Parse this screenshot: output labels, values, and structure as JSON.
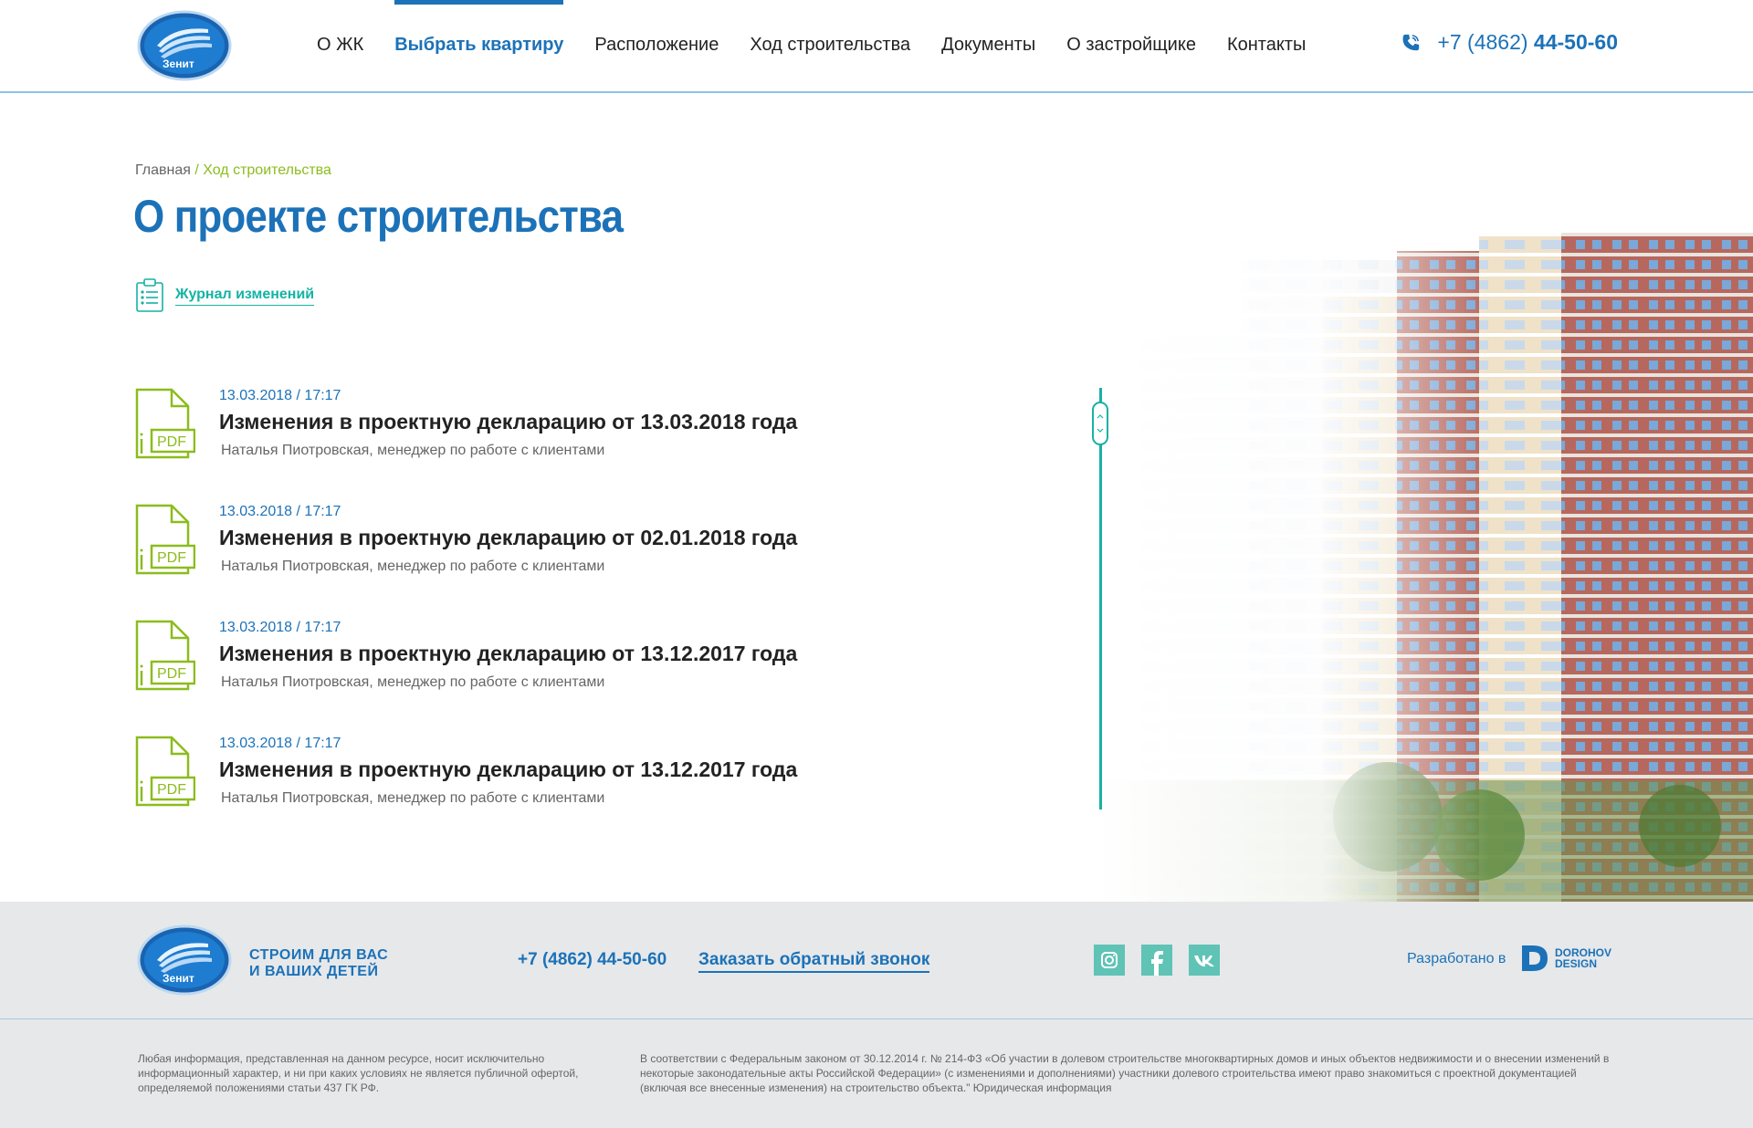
{
  "header": {
    "logo_text": "Зенит",
    "nav": [
      "О ЖК",
      "Выбрать квартиру",
      "Расположение",
      "Ход строительства",
      "Документы",
      "О застройщике",
      "Контакты"
    ],
    "active_index": 1,
    "phone_prefix": "+7 (4862)",
    "phone_number": "44-50-60"
  },
  "breadcrumb": {
    "home": "Главная",
    "separator": " / ",
    "current": "Ход строительства"
  },
  "page_title": "О проекте строительства",
  "journal_link": "Журнал изменений",
  "documents": [
    {
      "date": "13.03.2018 / 17:17",
      "title": "Изменения в проектную декларацию от 13.03.2018 года",
      "author": "Наталья Пиотровская, менеджер по работе с клиентами"
    },
    {
      "date": "13.03.2018 / 17:17",
      "title": "Изменения в проектную декларацию от 02.01.2018 года",
      "author": "Наталья Пиотровская, менеджер по работе с клиентами"
    },
    {
      "date": "13.03.2018 / 17:17",
      "title": "Изменения в проектную декларацию от 13.12.2017 года",
      "author": "Наталья Пиотровская, менеджер по работе с клиентами"
    },
    {
      "date": "13.03.2018 / 17:17",
      "title": "Изменения в проектную декларацию от 13.12.2017 года",
      "author": "Наталья Пиотровская, менеджер по работе с клиентами"
    }
  ],
  "pdf_label": "PDF",
  "footer": {
    "slogan_line1": "СТРОИМ ДЛЯ ВАС",
    "slogan_line2": "И ВАШИХ ДЕТЕЙ",
    "phone": "+7 (4862) 44-50-60",
    "callback": "Заказать обратный звонок",
    "social": [
      "instagram-icon",
      "facebook-icon",
      "vk-icon"
    ],
    "developed_by": "Разработано в",
    "developer_line1": "DOROHOV",
    "developer_line2": "DESIGN",
    "legal_left": "Любая информация, представленная на данном ресурсе, носит исключительно информационный характер, и ни при каких условиях не является публичной офертой, определяемой положениями статьи 437 ГК РФ.",
    "legal_right": "В соответствии с Федеральным законом от 30.12.2014 г. № 214-ФЗ «Об участии в долевом строительстве многоквартирных домов и иных объектов недвижимости и о внесении изменений в некоторые законодательные акты Российской Федерации» (с изменениями и дополнениями) участники долевого строительства имеют право знакомиться с проектной документацией (включая все внесенные изменения) на строительство объекта.\" Юридическая информация"
  },
  "colors": {
    "brand_blue": "#1c72b8",
    "accent_green": "#8cbc1d",
    "teal": "#17b1a3"
  }
}
